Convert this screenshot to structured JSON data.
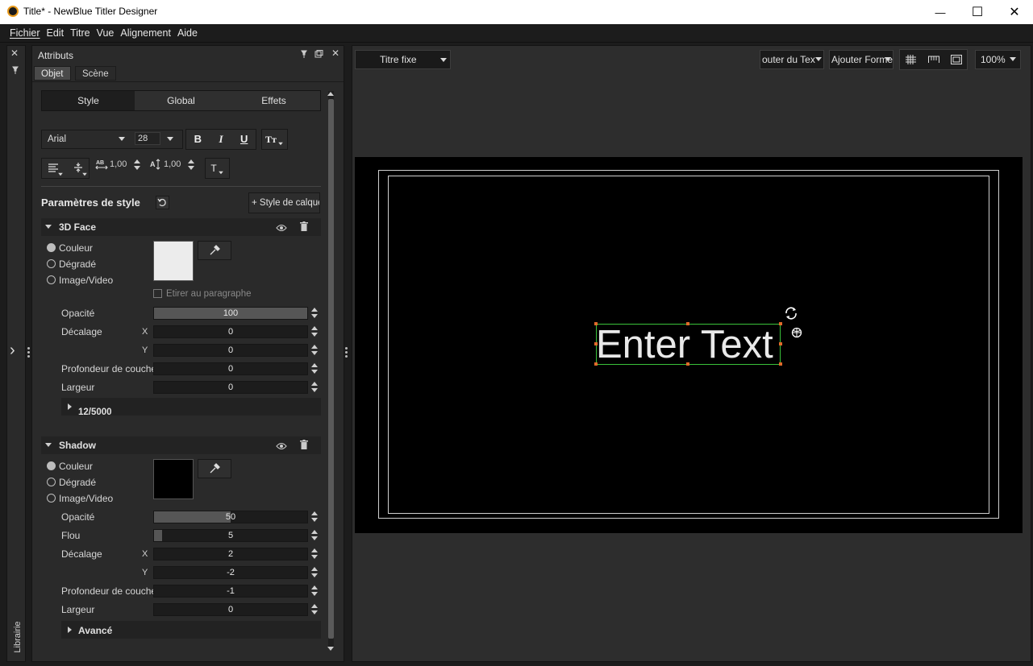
{
  "window": {
    "title": "Title* - NewBlue Titler Designer",
    "min_glyph": "—",
    "max_glyph": "☐",
    "close_glyph": "✕"
  },
  "menu": [
    "Fichier",
    "Edit",
    "Titre",
    "Vue",
    "Alignement",
    "Aide"
  ],
  "rail": {
    "close_glyph": "✕",
    "pin_glyph": "📌",
    "expand_glyph": "›",
    "library_label": "Librairie"
  },
  "panel": {
    "title": "Attributs",
    "tabs": [
      "Objet",
      "Scène"
    ],
    "active_tab": "Objet",
    "style_tabs": [
      "Style",
      "Global",
      "Effets"
    ],
    "active_style_tab": "Style",
    "font_family": "Arial",
    "font_size": "28",
    "bold": "B",
    "italic": "I",
    "underline": "U",
    "text_case": "Tт",
    "char_spacing": "1,00",
    "line_spacing": "1,00",
    "text_type": "T",
    "style_params_title": "Paramètres de style",
    "add_layer_style": "+ Style de calque",
    "face": {
      "title": "3D Face",
      "fill_options": [
        "Couleur",
        "Dégradé",
        "Image/Video"
      ],
      "selected_fill": "Couleur",
      "swatch_color": "#ececec",
      "stretch_label": "Etirer au paragraphe",
      "opacity_label": "Opacité",
      "opacity": "100",
      "opacity_fraction": 1.0,
      "offset_label": "Décalage",
      "offset_x": "0",
      "offset_y": "0",
      "depth_label": "Profondeur de couche",
      "depth": "0",
      "width_label": "Largeur",
      "width": "0",
      "char_count": "12/5000"
    },
    "shadow": {
      "title": "Shadow",
      "fill_options": [
        "Couleur",
        "Dégradé",
        "Image/Video"
      ],
      "selected_fill": "Couleur",
      "swatch_color": "#000000",
      "opacity_label": "Opacité",
      "opacity": "50",
      "opacity_fraction": 0.5,
      "blur_label": "Flou",
      "blur": "5",
      "blur_fraction": 0.05,
      "offset_label": "Décalage",
      "offset_x": "2",
      "offset_y": "-2",
      "depth_label": "Profondeur de couche",
      "depth": "-1",
      "width_label": "Largeur",
      "width": "0"
    },
    "advanced_label": "Avancé"
  },
  "canvas": {
    "title_type": "Titre fixe",
    "add_text": "outer du Tex",
    "add_shape": "Ajouter Forme",
    "zoom": "100%",
    "preview_text": "Enter Text",
    "accent_selection": "#3ac23a"
  }
}
